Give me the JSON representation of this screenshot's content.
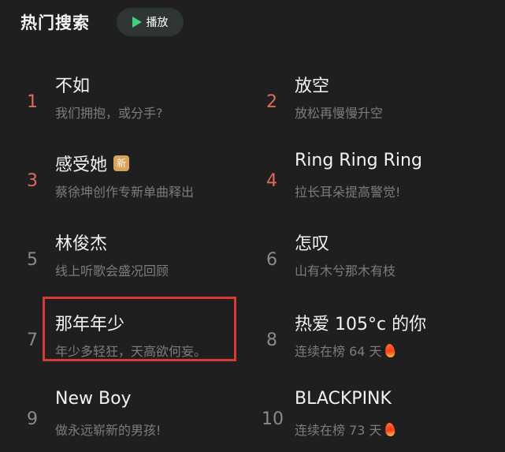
{
  "header": {
    "title": "热门搜索",
    "play_label": "播放"
  },
  "items": [
    {
      "rank": "1",
      "title": "不如",
      "desc": "我们拥抱，或分手?",
      "badge": "",
      "fire": false,
      "hot": true
    },
    {
      "rank": "2",
      "title": "放空",
      "desc": "放松再慢慢升空",
      "badge": "",
      "fire": false,
      "hot": true
    },
    {
      "rank": "3",
      "title": "感受她",
      "desc": "蔡徐坤创作专新单曲释出",
      "badge": "新",
      "fire": false,
      "hot": true
    },
    {
      "rank": "4",
      "title": "Ring Ring Ring",
      "desc": "拉长耳朵提高警觉!",
      "badge": "",
      "fire": false,
      "hot": true
    },
    {
      "rank": "5",
      "title": "林俊杰",
      "desc": "线上听歌会盛况回顾",
      "badge": "",
      "fire": false,
      "hot": false
    },
    {
      "rank": "6",
      "title": "怎叹",
      "desc": "山有木兮那木有枝",
      "badge": "",
      "fire": false,
      "hot": false
    },
    {
      "rank": "7",
      "title": "那年年少",
      "desc": "年少多轻狂，天高欲何妄。",
      "badge": "",
      "fire": false,
      "hot": false
    },
    {
      "rank": "8",
      "title": "热爱 105°c 的你",
      "desc": "连续在榜 64 天",
      "badge": "",
      "fire": true,
      "hot": false
    },
    {
      "rank": "9",
      "title": "New Boy",
      "desc": "做永远崭新的男孩!",
      "badge": "",
      "fire": false,
      "hot": false
    },
    {
      "rank": "10",
      "title": "BLACKPINK",
      "desc": "连续在榜 73 天",
      "badge": "",
      "fire": true,
      "hot": false
    }
  ],
  "colors": {
    "background": "#1f1f1f",
    "hot_rank": "#e06a5e",
    "normal_rank": "#8a8a8a",
    "play_icon": "#3ed37a",
    "highlight_border": "#d63b35"
  }
}
